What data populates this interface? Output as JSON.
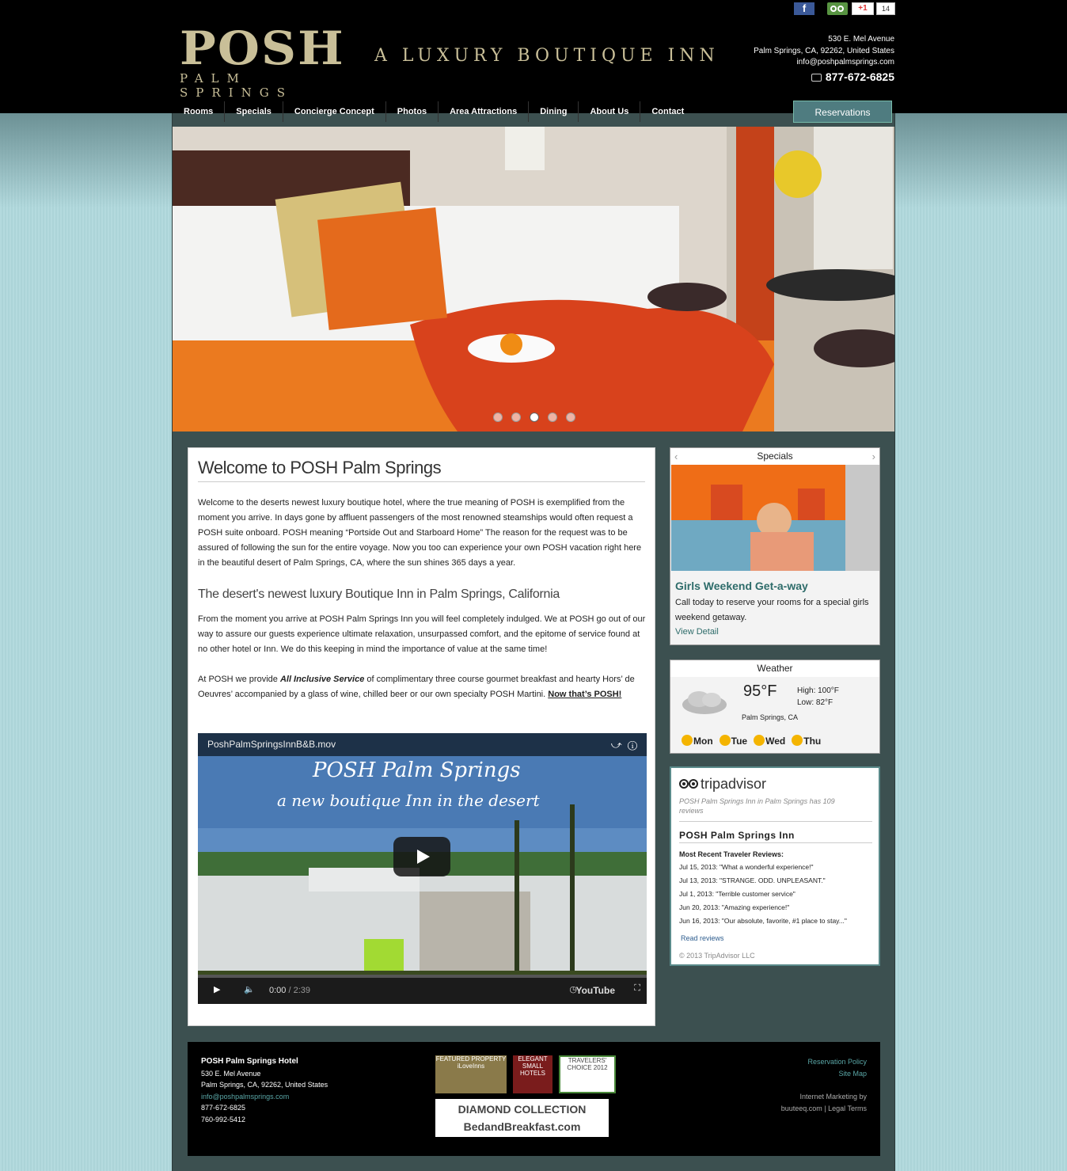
{
  "social": {
    "facebook": "f",
    "gplus": "+1",
    "gplus_count": "14"
  },
  "brand": {
    "logo_main": "POSH",
    "logo_sub": "PALM SPRINGS",
    "tagline": "A LUXURY BOUTIQUE INN"
  },
  "header_contact": {
    "street": "530 E. Mel Avenue",
    "city": "Palm Springs, CA, 92262, United States",
    "email": "info@poshpalmsprings.com",
    "phone": "877-672-6825"
  },
  "nav": {
    "items": [
      "Rooms",
      "Specials",
      "Concierge Concept",
      "Photos",
      "Area Attractions",
      "Dining",
      "About Us",
      "Contact"
    ],
    "reservations": "Reservations"
  },
  "hero": {
    "slide_count": 5,
    "active_slide": 3
  },
  "main": {
    "title": "Welcome to POSH Palm Springs",
    "p1": "Welcome to the deserts newest luxury boutique hotel, where the true meaning of POSH is exemplified from the moment you arrive. In days gone by affluent passengers of the most renowned steamships would often request a POSH suite onboard. POSH meaning “Portside Out and Starboard Home” The reason for the request was to be assured of following the sun for the entire voyage. Now you too can experience your own POSH vacation right here in the beautiful desert of Palm Springs, CA, where the sun shines 365 days a year.",
    "subtitle": "The desert's newest luxury Boutique Inn in Palm Springs, California",
    "p2": "From the moment you arrive at POSH Palm Springs Inn you will feel completely indulged. We at POSH go out of our way to assure our guests experience ultimate relaxation, unsurpassed comfort, and the epitome of service found at no other hotel or Inn. We do this keeping in mind the importance of value at the same time!",
    "p3_a": "At POSH we provide ",
    "p3_em": "All Inclusive Service",
    "p3_b": " of complimentary three course gourmet breakfast and hearty Hors’ de Oeuvres’ accompanied by a glass of wine, chilled beer or our own specialty POSH Martini. ",
    "p3_link": "Now that’s POSH!"
  },
  "video": {
    "file": "PoshPalmSpringsInnB&B.mov",
    "overlay_title": "POSH Palm Springs",
    "overlay_sub": "a new boutique Inn in the desert",
    "time_current": "0:00",
    "time_total": "/ 2:39",
    "brand": "YouTube"
  },
  "specials": {
    "heading": "Specials",
    "title": "Girls Weekend Get-a-way",
    "desc": "Call today to reserve your rooms for a special girls weekend getaway.",
    "link": "View Detail"
  },
  "weather": {
    "heading": "Weather",
    "temp": "95°F",
    "high": "High: 100°F",
    "low": "Low: 82°F",
    "location": "Palm Springs, CA",
    "days": [
      "Mon",
      "Tue",
      "Wed",
      "Thu"
    ]
  },
  "tripadvisor": {
    "logo": "tripadvisor",
    "sub": "POSH Palm Springs Inn in Palm Springs has 109 reviews",
    "name": "POSH Palm Springs Inn",
    "recent_heading": "Most Recent Traveler Reviews:",
    "reviews": [
      "Jul 15, 2013: \"What a wonderful experience!\"",
      "Jul 13, 2013: \"STRANGE. ODD. UNPLEASANT.\"",
      "Jul 1, 2013: \"Terrible customer service\"",
      "Jun 20, 2013: \"Amazing experience!\"",
      "Jun 16, 2013: \"Our absolute, favorite, #1 place to stay...\""
    ],
    "read": "Read reviews",
    "copyright": "© 2013 TripAdvisor LLC"
  },
  "footer": {
    "name": "POSH Palm Springs Hotel",
    "street": "530 E. Mel Avenue",
    "city": "Palm Springs, CA, 92262, United States",
    "email": "info@poshpalmsprings.com",
    "phone1": "877-672-6825",
    "phone2": "760-992-5412",
    "policy": "Reservation Policy",
    "sitemap": "Site Map",
    "marketing": "Internet Marketing by",
    "agency": "buuteeq.com",
    "legal": "Legal Terms",
    "badge1": "FEATURED PROPERTY iLoveInns",
    "badge2": "ELEGANT SMALL HOTELS",
    "badge3": "TRAVELERS' CHOICE 2012",
    "badge4": "DIAMOND COLLECTION BedandBreakfast.com"
  },
  "colors": {
    "accent": "#4f7c80",
    "gold": "#c9bf98",
    "link": "#2e6c6a"
  }
}
